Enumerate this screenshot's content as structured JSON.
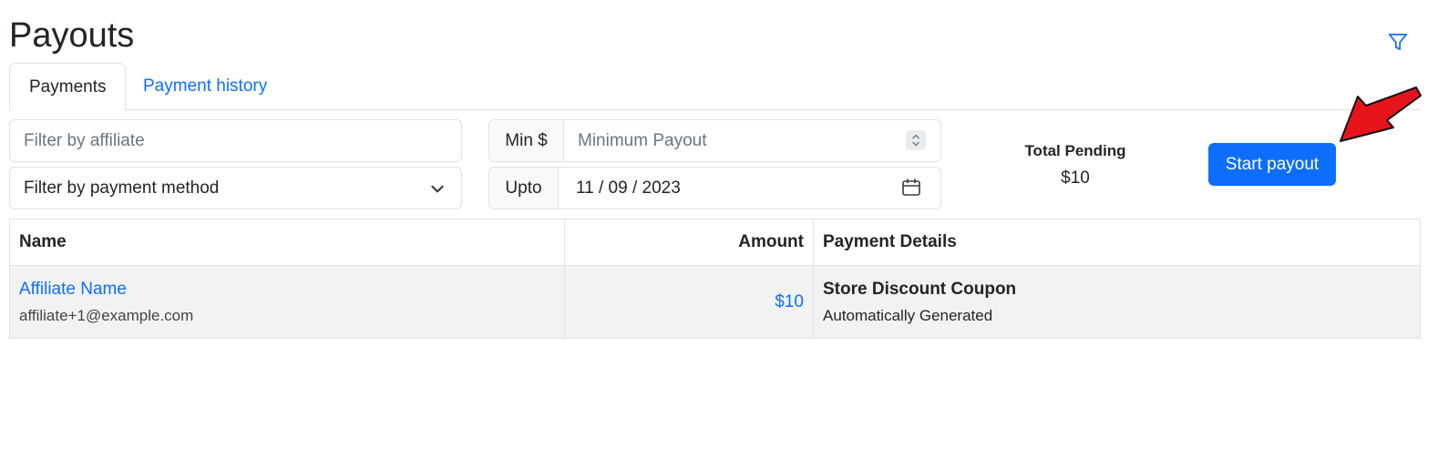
{
  "page": {
    "title": "Payouts"
  },
  "tabs": [
    {
      "label": "Payments",
      "active": true
    },
    {
      "label": "Payment history",
      "active": false
    }
  ],
  "filters": {
    "affiliate_placeholder": "Filter by affiliate",
    "payment_method_selected": "Filter by payment method",
    "min_label": "Min $",
    "min_placeholder": "Minimum Payout",
    "upto_label": "Upto",
    "upto_value": "11 / 09 / 2023"
  },
  "summary": {
    "total_pending_label": "Total Pending",
    "total_pending_value": "$10"
  },
  "actions": {
    "start_payout_label": "Start payout"
  },
  "table": {
    "headers": {
      "name": "Name",
      "amount": "Amount",
      "payment_details": "Payment Details"
    },
    "rows": [
      {
        "name": "Affiliate Name",
        "email": "affiliate+1@example.com",
        "amount": "$10",
        "details_title": "Store Discount Coupon",
        "details_sub": "Automatically Generated"
      }
    ]
  },
  "colors": {
    "primary": "#0d6efd",
    "annotation_arrow": "#e8141b",
    "border": "#dee2e6",
    "row_bg": "#f2f2f2"
  },
  "icons": {
    "filter": "funnel-icon",
    "select": "chevron-down-icon",
    "date": "calendar-icon",
    "number": "spinner-icon"
  }
}
